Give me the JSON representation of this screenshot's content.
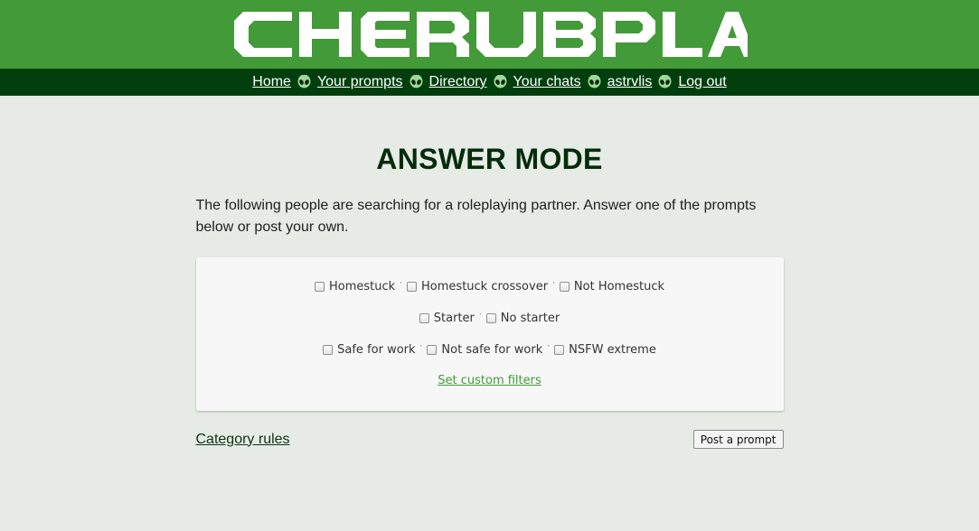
{
  "header": {
    "logo_text": "CHERUBPLAY",
    "accent_color": "#439a38",
    "nav_bg": "#003f0d"
  },
  "nav": {
    "items": [
      {
        "label": "Home"
      },
      {
        "label": "Your prompts"
      },
      {
        "label": "Directory"
      },
      {
        "label": "Your chats"
      },
      {
        "label": "astrvlis"
      },
      {
        "label": "Log out"
      }
    ],
    "separator_icon": "alien-head-icon"
  },
  "main": {
    "title": "ANSWER MODE",
    "intro": "The following people are searching for a roleplaying partner. Answer one of the prompts below or post your own."
  },
  "filters": {
    "rows": [
      [
        "Homestuck",
        "Homestuck crossover",
        "Not Homestuck"
      ],
      [
        "Starter",
        "No starter"
      ],
      [
        "Safe for work",
        "Not safe for work",
        "NSFW extreme"
      ]
    ],
    "separator": "·",
    "custom_link": "Set custom filters"
  },
  "footer": {
    "category_rules": "Category rules",
    "post_prompt": "Post a prompt"
  }
}
